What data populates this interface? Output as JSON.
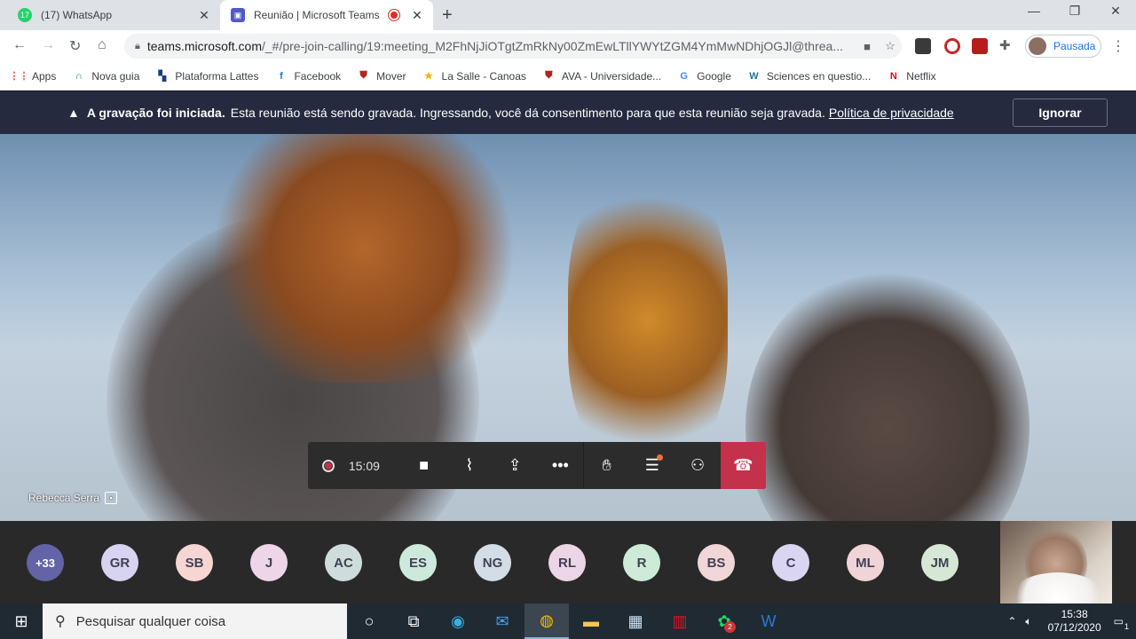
{
  "tabs": [
    {
      "title": "(17) WhatsApp",
      "badge": "17",
      "favicon_color": "#25d366",
      "close": "✕"
    },
    {
      "title": "Reunião | Microsoft Teams",
      "favicon_color": "#5059c9",
      "close": "✕"
    }
  ],
  "window_controls": {
    "minimize": "—",
    "restore": "❐",
    "close": "✕"
  },
  "new_tab": "+",
  "address": {
    "host": "teams.microsoft.com",
    "path": "/_#/pre-join-calling/19:meeting_M2FhNjJiOTgtZmRkNy00ZmEwLTllYWYtZGM4YmMwNDhjOGJl@threa..."
  },
  "profile": {
    "label": "Pausada"
  },
  "bookmarks": [
    {
      "label": "Apps",
      "icon": "apps-grid-icon",
      "color": "#ea4335",
      "glyph": "⋮⋮"
    },
    {
      "label": "Nova guia",
      "icon": "new-tab-icon",
      "color": "#1e8e3e",
      "glyph": "∩"
    },
    {
      "label": "Plataforma Lattes",
      "icon": "lattes-icon",
      "color": "#1a3d7c",
      "glyph": "▚"
    },
    {
      "label": "Facebook",
      "icon": "facebook-icon",
      "color": "#1877f2",
      "glyph": "f"
    },
    {
      "label": "Mover",
      "icon": "shield-icon",
      "color": "#b3261e",
      "glyph": "⛊"
    },
    {
      "label": "La Salle - Canoas",
      "icon": "star-icon",
      "color": "#f4b400",
      "glyph": "★"
    },
    {
      "label": "AVA - Universidade...",
      "icon": "shield-icon",
      "color": "#b3261e",
      "glyph": "⛊"
    },
    {
      "label": "Google",
      "icon": "google-icon",
      "color": "#4285f4",
      "glyph": "G"
    },
    {
      "label": "Sciences en questio...",
      "icon": "wordpress-icon",
      "color": "#21759b",
      "glyph": "W"
    },
    {
      "label": "Netflix",
      "icon": "netflix-icon",
      "color": "#e50914",
      "glyph": "N"
    }
  ],
  "banner": {
    "bold": "A gravação foi iniciada.",
    "text": "Esta reunião está sendo gravada. Ingressando, você dá consentimento para que esta reunião seja gravada.",
    "link": "Política de privacidade",
    "button": "Ignorar"
  },
  "stage": {
    "participant_name": "Rebecca Serra"
  },
  "callbar": {
    "timer": "15:09"
  },
  "roster": [
    {
      "initials": "+33",
      "color": "#6264a7"
    },
    {
      "initials": "GR",
      "color": "#d7d3f0"
    },
    {
      "initials": "SB",
      "color": "#f5d6d2"
    },
    {
      "initials": "J",
      "color": "#eed5e8"
    },
    {
      "initials": "AC",
      "color": "#cfdcdc"
    },
    {
      "initials": "ES",
      "color": "#cde9dc"
    },
    {
      "initials": "NG",
      "color": "#d2dde5"
    },
    {
      "initials": "RL",
      "color": "#ecd5e5"
    },
    {
      "initials": "R",
      "color": "#cdebd6"
    },
    {
      "initials": "BS",
      "color": "#f0d6d6"
    },
    {
      "initials": "C",
      "color": "#dad6f2"
    },
    {
      "initials": "ML",
      "color": "#f0d4d8"
    },
    {
      "initials": "JM",
      "color": "#d6e7d6"
    }
  ],
  "taskbar": {
    "search_placeholder": "Pesquisar qualquer coisa",
    "time": "15:38",
    "date": "07/12/2020",
    "whatsapp_badge": "2",
    "notification_count": "1"
  }
}
